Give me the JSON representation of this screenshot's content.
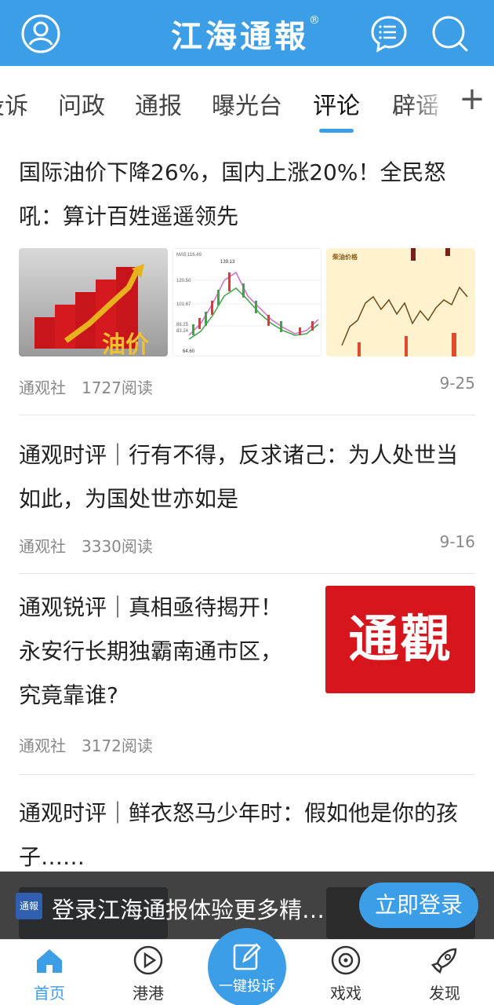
{
  "header": {
    "logo": "江海通報",
    "trademark": "®",
    "avatar_icon": "user-icon",
    "message_icon": "chat-icon",
    "search_icon": "search-icon"
  },
  "tabs": {
    "items": [
      "投诉",
      "问政",
      "通报",
      "曝光台",
      "评论",
      "辟谣"
    ],
    "active": "评论",
    "add_label": "+"
  },
  "articles": [
    {
      "title": "国际油价下降26%，国内上涨20%！全民怒吼：算计百姓遥遥领先",
      "source": "通观社",
      "reads": "1727阅读",
      "date": "9-25",
      "image_texts": [
        "油价",
        "MA5:116.49",
        "139.13",
        "120.50",
        "101.87",
        "88.25",
        "83.24",
        "64.60",
        "柴油价格"
      ]
    },
    {
      "title": "通观时评｜行有不得，反求诸己：为人处世当如此，为国处世亦如是",
      "source": "通观社",
      "reads": "3330阅读",
      "date": "9-16"
    },
    {
      "title": "通观锐评｜真相亟待揭开！永安行长期独霸南通市区，究竟靠谁?",
      "source": "通观社",
      "reads": "3172阅读",
      "image_text": "通觀"
    },
    {
      "title": "通观时评｜鲜衣怒马少年时：假如他是你的孩子……"
    }
  ],
  "banner": {
    "logo_text": "通報",
    "text": "登录江海通报体验更多精彩内容",
    "button": "立即登录"
  },
  "nav": {
    "items": [
      {
        "label": "首页",
        "icon": "home-icon"
      },
      {
        "label": "港港",
        "icon": "play-icon"
      },
      {
        "label": "一键投诉",
        "icon": "edit-icon"
      },
      {
        "label": "戏戏",
        "icon": "film-icon"
      },
      {
        "label": "发现",
        "icon": "rocket-icon"
      }
    ],
    "active": "首页"
  },
  "colors": {
    "brand": "#3d9ee8",
    "logo_red": "#d7151d"
  }
}
